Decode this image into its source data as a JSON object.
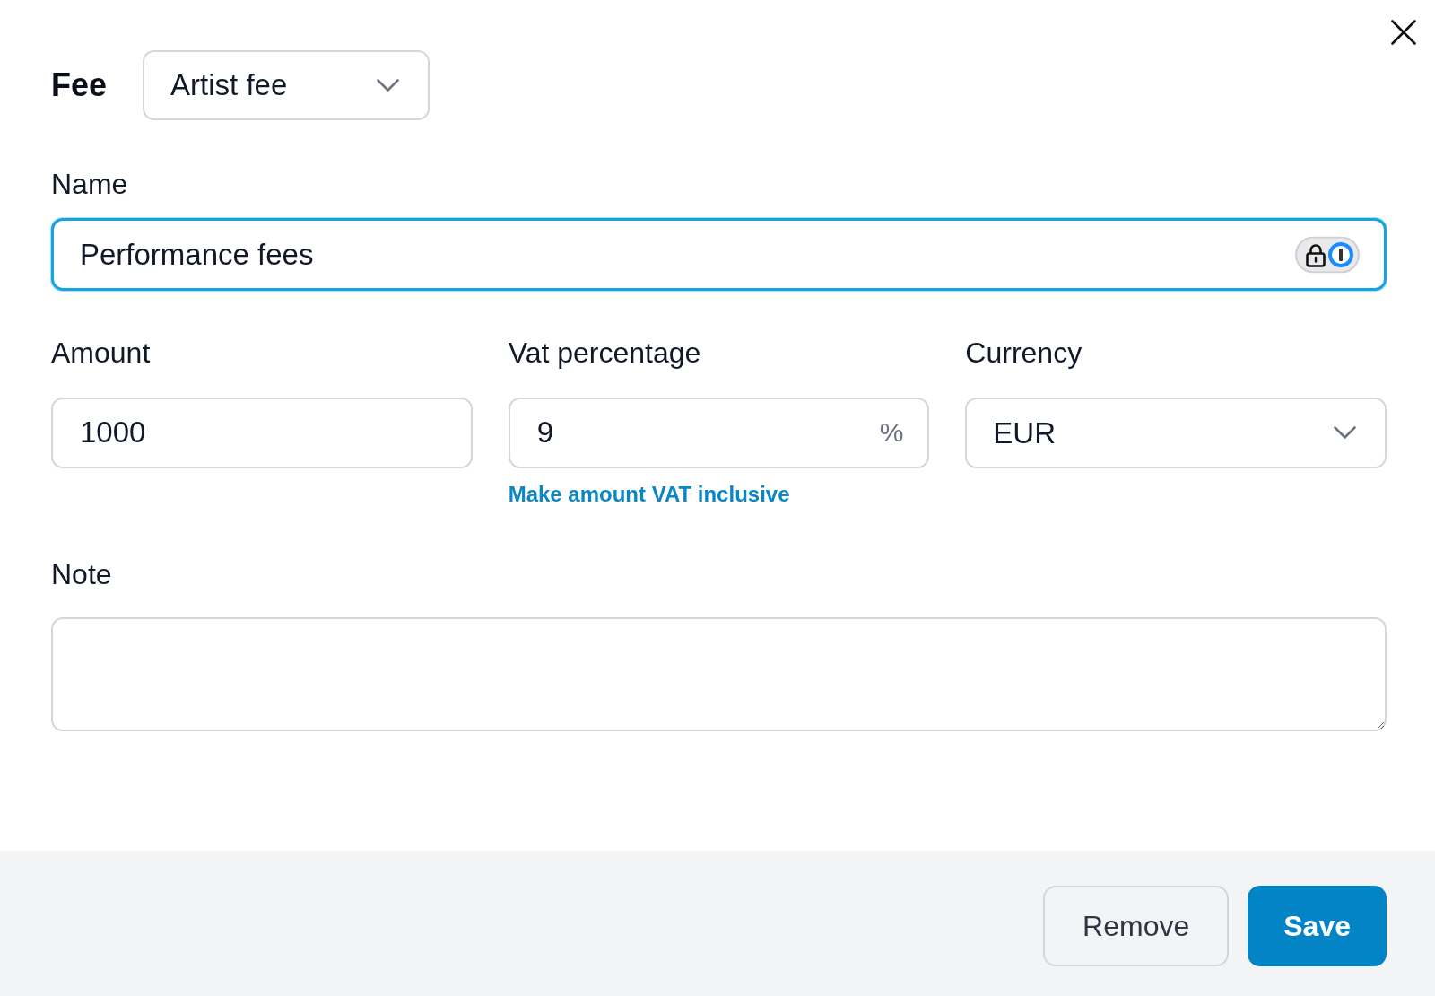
{
  "fee": {
    "label": "Fee",
    "value": "Artist fee"
  },
  "name_field": {
    "label": "Name",
    "value": "Performance fees",
    "focused": true
  },
  "fields": [
    {
      "kind": "text",
      "label": "Amount",
      "value": "1000"
    },
    {
      "kind": "unit",
      "label": "Vat percentage",
      "value": "9",
      "unit": "%",
      "link": "Make amount VAT inclusive"
    },
    {
      "kind": "select",
      "label": "Currency",
      "value": "EUR"
    }
  ],
  "note": {
    "label": "Note"
  },
  "footer": {
    "buttons": [
      {
        "kind": "secondary",
        "label": "Remove"
      },
      {
        "kind": "primary",
        "label": "Save"
      }
    ]
  }
}
